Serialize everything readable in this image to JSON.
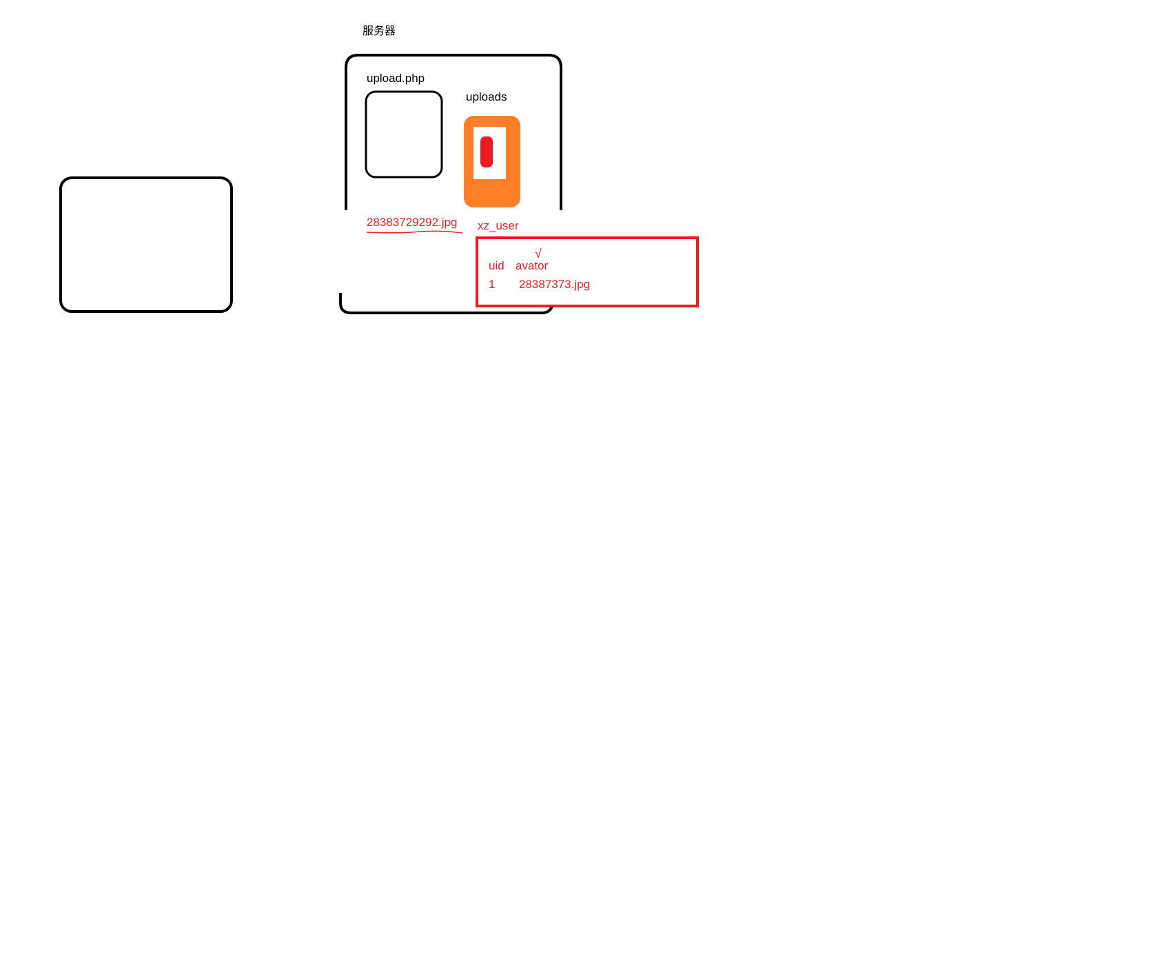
{
  "server": {
    "title": "服务器",
    "script_label": "upload.php",
    "folder_label": "uploads"
  },
  "upload": {
    "filename": "28383729292.jpg"
  },
  "db": {
    "table_name": "xz_user",
    "columns": [
      "uid",
      "avator"
    ],
    "check_mark": "√",
    "rows": [
      {
        "uid": "1",
        "avator": "28387373.jpg"
      }
    ]
  },
  "colors": {
    "outline": "#000000",
    "annotation_red": "#ed1c24",
    "folder_orange": "#ff7f27",
    "background": "#ffffff"
  }
}
